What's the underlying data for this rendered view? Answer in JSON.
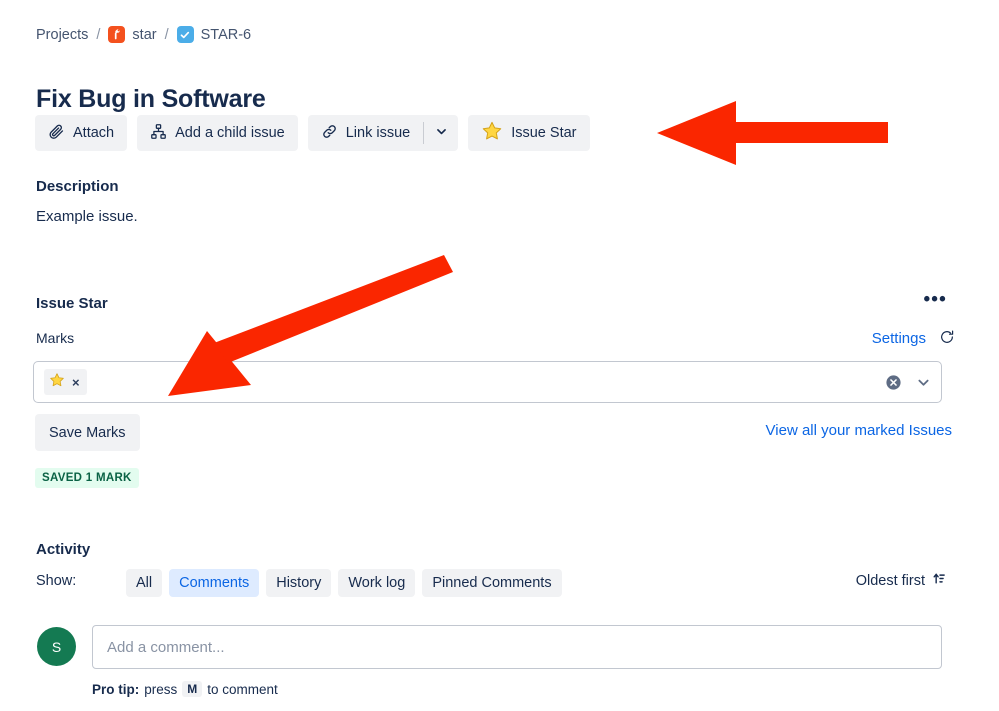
{
  "breadcrumb": {
    "projects_label": "Projects",
    "separator": "/",
    "project_icon": "wrench-icon",
    "project_label": "star",
    "issue_icon": "task-checkmark-icon",
    "issue_key": "STAR-6"
  },
  "issue": {
    "title": "Fix Bug in Software"
  },
  "toolbar": {
    "attach_label": "Attach",
    "attach_icon": "paperclip-icon",
    "child_issue_label": "Add a child issue",
    "child_issue_icon": "hierarchy-icon",
    "link_issue_label": "Link issue",
    "link_issue_icon": "link-chain-icon",
    "more_icon": "chevron-down-icon",
    "issue_star_label": "Issue Star",
    "issue_star_icon": "star-icon"
  },
  "description": {
    "heading": "Description",
    "body": "Example issue."
  },
  "issue_star_panel": {
    "heading": "Issue Star",
    "more_icon": "ellipsis-icon",
    "more_label": "•••",
    "marks_label": "Marks",
    "settings_label": "Settings",
    "refresh_icon": "refresh-icon",
    "selected_mark_icon": "star-icon",
    "chip_remove_label": "×",
    "clear_icon": "clear-circle-icon",
    "dropdown_icon": "chevron-down-icon",
    "save_label": "Save Marks",
    "view_all_label": "View all your marked Issues",
    "saved_badge": "SAVED 1 MARK"
  },
  "activity": {
    "heading": "Activity",
    "show_label": "Show:",
    "filters": [
      {
        "label": "All",
        "selected": false
      },
      {
        "label": "Comments",
        "selected": true
      },
      {
        "label": "History",
        "selected": false
      },
      {
        "label": "Work log",
        "selected": false
      },
      {
        "label": "Pinned Comments",
        "selected": false
      }
    ],
    "sort_label": "Oldest first",
    "sort_icon": "sort-ascending-icon"
  },
  "comment": {
    "avatar_initial": "S",
    "placeholder": "Add a comment...",
    "value": "",
    "tip_prefix": "Pro tip:",
    "tip_middle": "press",
    "tip_key": "M",
    "tip_suffix": "to comment"
  },
  "annotations": {
    "arrow_color": "#FA2600",
    "arrow_1_target": "issue-star-button",
    "arrow_2_target": "marks-select-field"
  },
  "colors": {
    "link": "#0c66e4",
    "text": "#172b4d",
    "badge_bg": "#e3fcef",
    "badge_text": "#0a6245",
    "selected_tab_bg": "#deebff",
    "button_bg": "#f1f2f4",
    "avatar_bg": "#147a52",
    "project_icon_bg": "#f4511e",
    "task_icon_bg": "#4bade8",
    "star_fill": "#ffd33d"
  }
}
